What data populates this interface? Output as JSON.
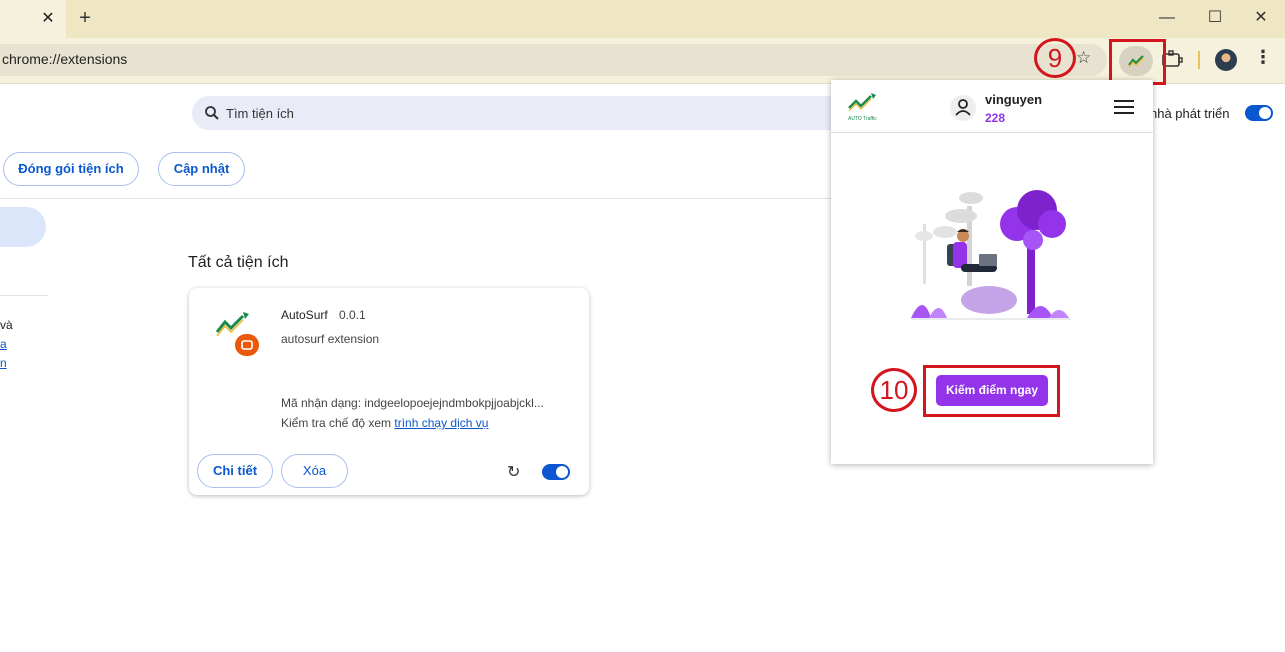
{
  "browser": {
    "tab_close": "✕",
    "new_tab": "+",
    "window_controls": [
      "—",
      "☐",
      "✕"
    ],
    "url": "chrome://extensions",
    "menu_glyph": "⋮"
  },
  "page": {
    "search_placeholder": "Tìm tiện ích",
    "developer_mode_label": "nhà phát triển",
    "developer_mode_on": true,
    "buttons": {
      "pack": "Đóng gói tiện ích",
      "update": "Cập nhật"
    },
    "sidebar_snippets": [
      "và",
      "a",
      "n"
    ],
    "section_title": "Tất cả tiện ích"
  },
  "extension_card": {
    "name": "AutoSurf",
    "version": "0.0.1",
    "description": "autosurf extension",
    "id_line": "Mã nhận dạng: indgeelopoejejndmbokpjjoabjckl...",
    "inspect_prefix": "Kiểm tra chế độ xem",
    "inspect_link": "trình chạy dịch vụ",
    "details_button": "Chi tiết",
    "remove_button": "Xóa",
    "enabled": true
  },
  "popup": {
    "logo_text": "AUTO Traffic",
    "username": "vinguyen",
    "points": "228",
    "cta_button": "Kiếm điểm ngay"
  },
  "annotations": {
    "step_9": "9",
    "step_10": "10"
  },
  "colors": {
    "accent_blue": "#0b57d0",
    "brand_purple": "#9333ea",
    "annotation_red": "#d4161c"
  }
}
